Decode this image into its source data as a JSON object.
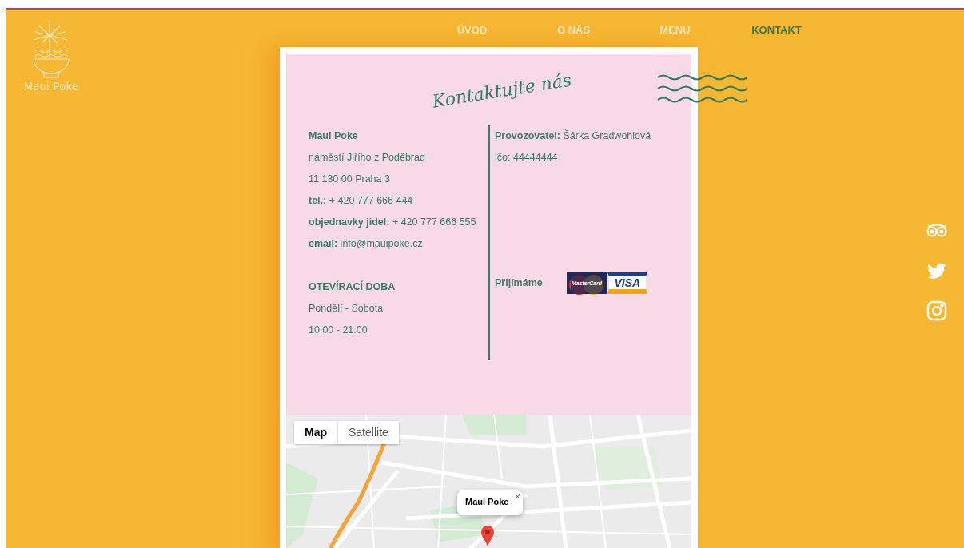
{
  "logo": {
    "name": "Maui Poke"
  },
  "nav": [
    {
      "label": "ÚVOD",
      "selected": false
    },
    {
      "label": "O NÁS",
      "selected": false
    },
    {
      "label": "MENU",
      "selected": false
    },
    {
      "label": "KONTAKT",
      "selected": true
    }
  ],
  "contact": {
    "title": "Kontaktujte nás",
    "name": "Maui Poke",
    "address": [
      "náměstí Jiřího z Poděbrad",
      "11 130 00 Praha 3",
      "**tel.:** + 420 777 666 444",
      "**objednavky jidel:** + 420 777 666 555",
      "**email:** info@mauipoke.cz"
    ],
    "hours": {
      "heading": "OTEVÍRACÍ DOBA",
      "lines": [
        "Pondělí - Sobota",
        "10:00 - 21:00"
      ]
    },
    "operator": "**Provozovatel:** Šárka Gradwohlová",
    "ico": "ičo: 44444444",
    "payments": {
      "label": "Přijímáme",
      "cards": [
        {
          "kind": "mastercard",
          "text": "MasterCard"
        },
        {
          "kind": "visa",
          "text": "VISA"
        }
      ]
    }
  },
  "map": {
    "types": [
      {
        "label": "Map",
        "selected": true
      },
      {
        "label": "Satellite",
        "selected": false
      }
    ],
    "info": {
      "title": "Maui Poke",
      "close": "×"
    }
  },
  "social": [
    {
      "kind": "tripadvisor"
    },
    {
      "kind": "twitter"
    },
    {
      "kind": "instagram"
    }
  ]
}
